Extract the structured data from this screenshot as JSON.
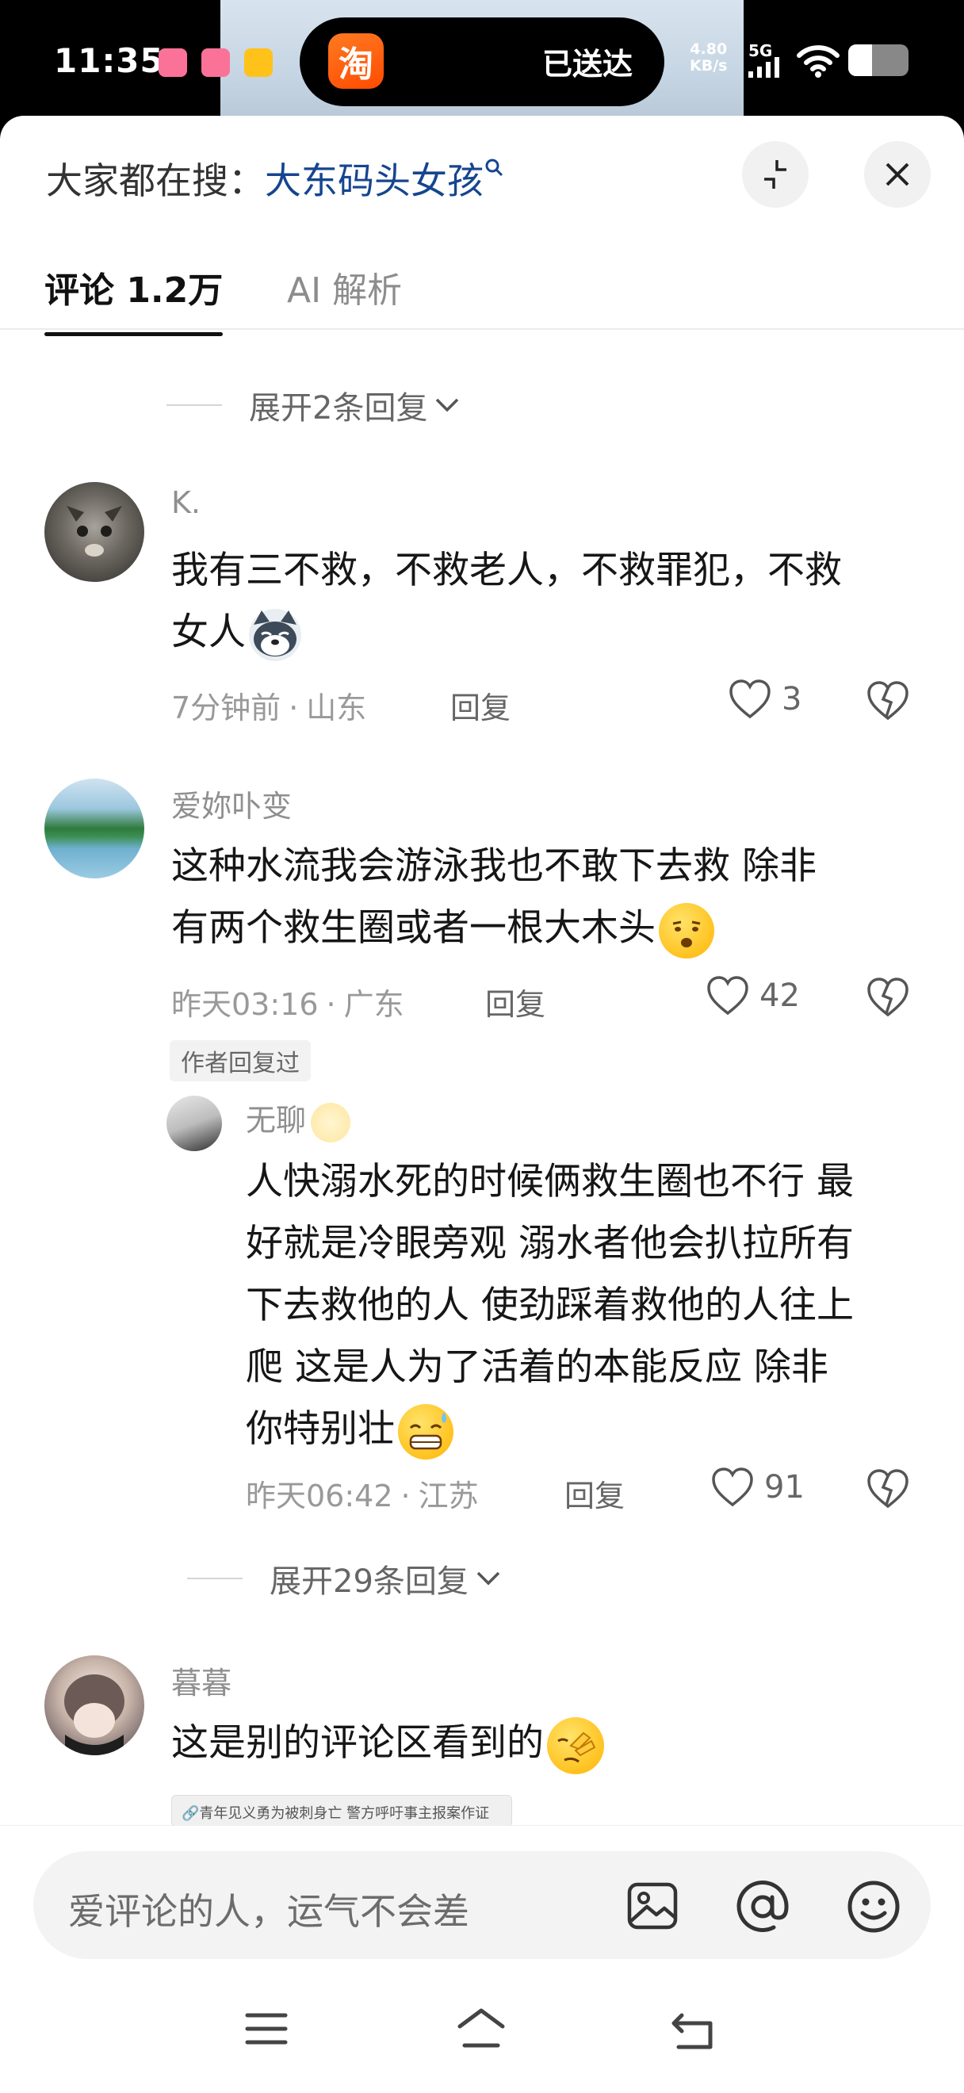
{
  "status_bar": {
    "time": "11:35",
    "island_app": "淘",
    "island_text": "已送达",
    "net_speed_value": "4.80",
    "net_speed_unit": "KB/s",
    "network": "5G"
  },
  "header": {
    "search_prefix": "大家都在搜：",
    "search_keyword": "大东码头女孩",
    "tabs": [
      {
        "label": "评论 1.2万",
        "active": true
      },
      {
        "label": "AI 解析",
        "active": false
      }
    ]
  },
  "expand_top": "展开2条回复",
  "comments": [
    {
      "username": "K.",
      "text_line1": "我有三不救，不救老人，不救罪犯，不救",
      "text_line2": "女人",
      "time": "7分钟前",
      "location": "山东",
      "reply_label": "回复",
      "likes": "3"
    },
    {
      "username": "爱妳卟变",
      "text_line1": "这种水流我会游泳我也不敢下去救 除非",
      "text_line2": "有两个救生圈或者一根大木头",
      "time": "昨天03:16",
      "location": "广东",
      "reply_label": "回复",
      "likes": "42",
      "author_badge": "作者回复过"
    },
    {
      "username": "暮暮",
      "text_line1": "这是别的评论区看到的",
      "preview_caption": "青年见义勇为被刺身亡 警方呼吁事主报案作证"
    }
  ],
  "nested_reply": {
    "username": "无聊",
    "lines": [
      "人快溺水死的时候俩救生圈也不行 最",
      "好就是冷眼旁观 溺水者他会扒拉所有",
      "下去救他的人 使劲踩着救他的人往上",
      "爬 这是人为了活着的本能反应 除非",
      "你特别壮"
    ],
    "time": "昨天06:42",
    "location": "江苏",
    "reply_label": "回复",
    "likes": "91"
  },
  "expand_bottom": "展开29条回复",
  "input": {
    "placeholder": "爱评论的人，运气不会差"
  },
  "meta_separator": "·"
}
